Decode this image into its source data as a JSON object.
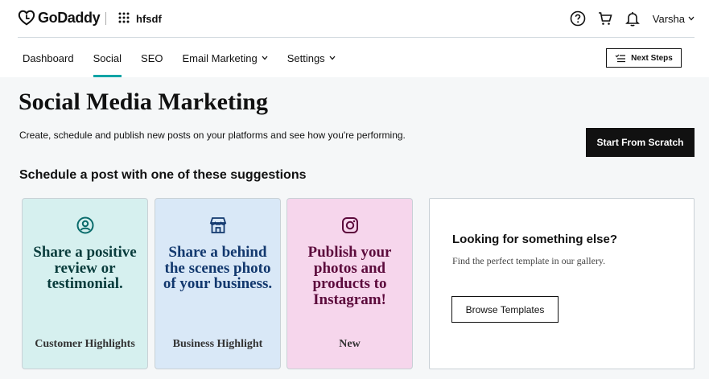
{
  "header": {
    "brand": "GoDaddy",
    "site_name": "hfsdf",
    "user_name": "Varsha",
    "icons": [
      "help-icon",
      "cart-icon",
      "bell-icon"
    ]
  },
  "nav": {
    "items": [
      {
        "label": "Dashboard",
        "active": false,
        "dropdown": false
      },
      {
        "label": "Social",
        "active": true,
        "dropdown": false
      },
      {
        "label": "SEO",
        "active": false,
        "dropdown": false
      },
      {
        "label": "Email Marketing",
        "active": false,
        "dropdown": true
      },
      {
        "label": "Settings",
        "active": false,
        "dropdown": true
      }
    ],
    "next_steps_label": "Next Steps"
  },
  "main": {
    "title": "Social Media Marketing",
    "description": "Create, schedule and publish new posts on your platforms and see how you're performing.",
    "start_button": "Start From Scratch",
    "section_title": "Schedule a post with one of these suggestions",
    "cards": [
      {
        "icon": "review-person-icon",
        "text": "Share a positive review or testimonial.",
        "tag": "Customer Highlights",
        "color": "#d6f0ef"
      },
      {
        "icon": "storefront-icon",
        "text": "Share a behind the scenes photo of your business.",
        "tag": "Business Highlight",
        "color": "#d9e8f7"
      },
      {
        "icon": "instagram-icon",
        "text": "Publish your photos and products to Instagram!",
        "tag": "New",
        "color": "#f6d6ec"
      }
    ],
    "gallery": {
      "title": "Looking for something else?",
      "description": "Find the perfect template in our gallery.",
      "button": "Browse Templates"
    }
  }
}
